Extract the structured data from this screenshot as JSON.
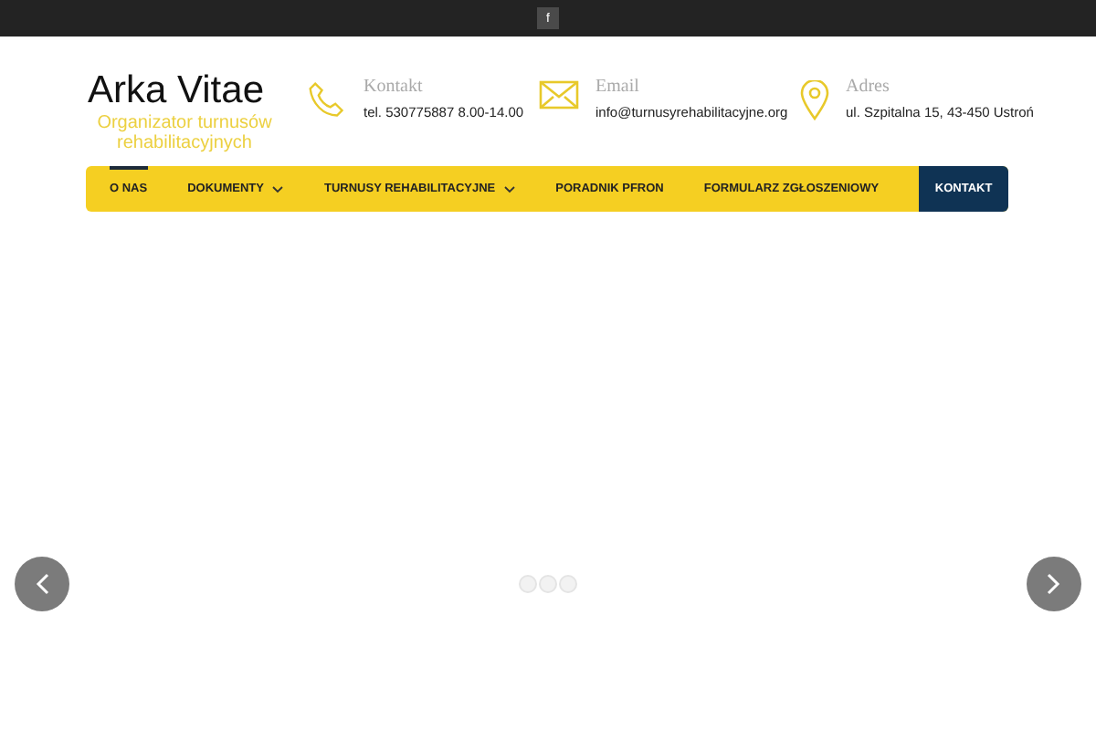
{
  "top_bar": {
    "social": "f"
  },
  "logo": {
    "title": "Arka Vitae",
    "subtitle": "Organizator turnusów rehabilitacyjnych"
  },
  "contacts": [
    {
      "kind": "phone",
      "label": "Kontakt",
      "value": "tel. 530775887 8.00-14.00"
    },
    {
      "kind": "email",
      "label": "Email",
      "value": "info@turnusyrehabilitacyjne.org"
    },
    {
      "kind": "pin",
      "label": "Adres",
      "value": "ul. Szpitalna 15, 43-450 Ustroń"
    }
  ],
  "nav": [
    {
      "label": "O NAS",
      "selected": true,
      "dropdown": false
    },
    {
      "label": "DOKUMENTY",
      "selected": false,
      "dropdown": true
    },
    {
      "label": "TURNUSY REHABILITACYJNE",
      "selected": false,
      "dropdown": true
    },
    {
      "label": "PORADNIK PFRON",
      "selected": false,
      "dropdown": false
    },
    {
      "label": "FORMULARZ ZGŁOSZENIOWY",
      "selected": false,
      "dropdown": false
    }
  ],
  "nav_button": "KONTAKT",
  "slider": {
    "dots": [
      {
        "selected": false
      },
      {
        "selected": false
      },
      {
        "selected": false
      }
    ]
  }
}
